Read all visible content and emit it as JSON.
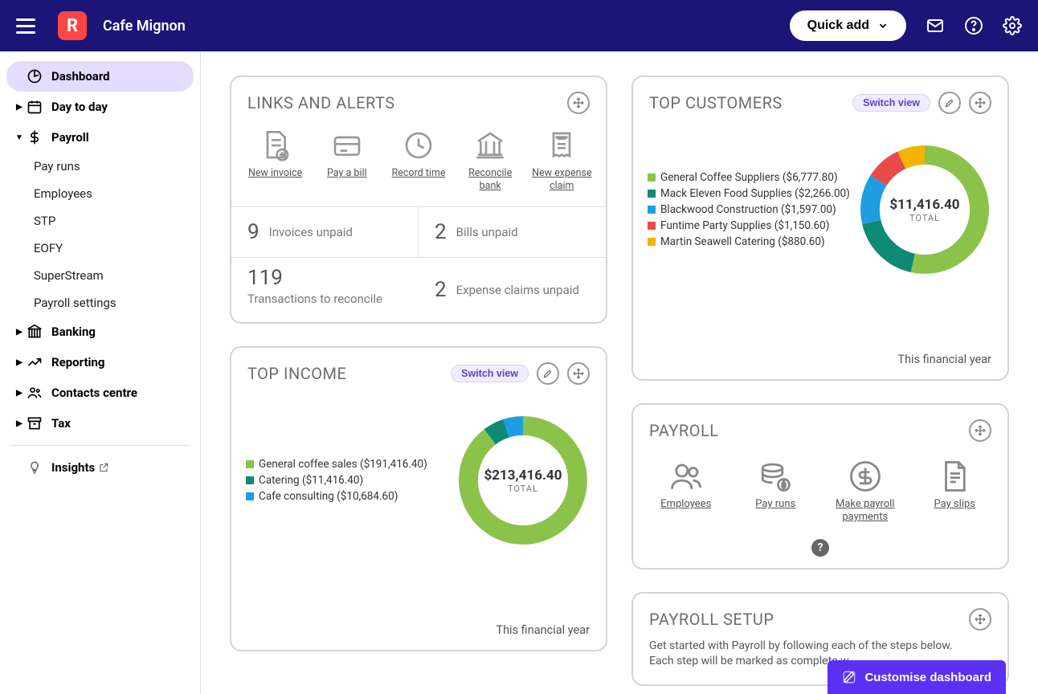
{
  "header": {
    "company_name": "Cafe Mignon",
    "quick_add_label": "Quick add"
  },
  "sidebar": {
    "items": [
      {
        "key": "dashboard",
        "label": "Dashboard",
        "active": true,
        "expandable": false
      },
      {
        "key": "day_to_day",
        "label": "Day to day",
        "expandable": true,
        "expanded": false
      },
      {
        "key": "payroll",
        "label": "Payroll",
        "expandable": true,
        "expanded": true,
        "children": [
          {
            "key": "pay_runs",
            "label": "Pay runs"
          },
          {
            "key": "employees",
            "label": "Employees"
          },
          {
            "key": "stp",
            "label": "STP"
          },
          {
            "key": "eofy",
            "label": "EOFY"
          },
          {
            "key": "superstream",
            "label": "SuperStream"
          },
          {
            "key": "payroll_settings",
            "label": "Payroll settings"
          }
        ]
      },
      {
        "key": "banking",
        "label": "Banking",
        "expandable": true,
        "expanded": false
      },
      {
        "key": "reporting",
        "label": "Reporting",
        "expandable": true,
        "expanded": false
      },
      {
        "key": "contacts",
        "label": "Contacts centre",
        "expandable": true,
        "expanded": false
      },
      {
        "key": "tax",
        "label": "Tax",
        "expandable": true,
        "expanded": false
      }
    ],
    "insights_label": "Insights"
  },
  "links_card": {
    "title": "LINKS AND ALERTS",
    "quick_links": [
      {
        "key": "new_invoice",
        "label": "New invoice"
      },
      {
        "key": "pay_bill",
        "label": "Pay a bill"
      },
      {
        "key": "record_time",
        "label": "Record time"
      },
      {
        "key": "reconcile",
        "label": "Reconcile bank"
      },
      {
        "key": "new_expense",
        "label": "New expense claim"
      }
    ],
    "stats": {
      "invoices_unpaid_num": "9",
      "invoices_unpaid_cap": "Invoices unpaid",
      "bills_unpaid_num": "2",
      "bills_unpaid_cap": "Bills unpaid",
      "tx_reconcile_num": "119",
      "tx_reconcile_cap": "Transactions to reconcile",
      "expense_unpaid_num": "2",
      "expense_unpaid_cap": "Expense claims unpaid"
    }
  },
  "top_income": {
    "title": "TOP INCOME",
    "switch_view": "Switch view",
    "total": "$213,416.40",
    "total_label": "TOTAL",
    "footer": "This financial year",
    "legend": [
      {
        "label": "General coffee sales ($191,416.40)",
        "color": "#8bc34a",
        "value": 191416.4
      },
      {
        "label": "Catering ($11,416.40)",
        "color": "#0e8a74",
        "value": 11416.4
      },
      {
        "label": "Cafe consulting ($10,684.60)",
        "color": "#1e9ee1",
        "value": 10684.6
      }
    ]
  },
  "top_customers": {
    "title": "TOP CUSTOMERS",
    "switch_view": "Switch view",
    "total": "$11,416.40",
    "total_label": "TOTAL",
    "footer": "This financial year",
    "legend": [
      {
        "label": "General Coffee Suppliers ($6,777.80)",
        "color": "#8bc34a",
        "value": 6777.8
      },
      {
        "label": "Mack Eleven Food Supplies ($2,266.00)",
        "color": "#0e8a74",
        "value": 2266.0
      },
      {
        "label": "Blackwood Construction ($1,597.00)",
        "color": "#1e9ee1",
        "value": 1597.0
      },
      {
        "label": "Funtime Party Supplies ($1,150.60)",
        "color": "#e94b4b",
        "value": 1150.6
      },
      {
        "label": "Martin Seawell Catering ($880.60)",
        "color": "#f4b400",
        "value": 880.6
      }
    ]
  },
  "payroll_card": {
    "title": "PAYROLL",
    "links": [
      {
        "key": "employees",
        "label": "Employees"
      },
      {
        "key": "pay_runs",
        "label": "Pay runs"
      },
      {
        "key": "payments",
        "label": "Make payroll payments"
      },
      {
        "key": "pay_slips",
        "label": "Pay slips"
      }
    ]
  },
  "payroll_setup": {
    "title": "PAYROLL SETUP",
    "line1": "Get started with Payroll by following each of the steps below.",
    "line2": "Each step will be marked as complete w"
  },
  "customise_label": "Customise dashboard",
  "chart_data": [
    {
      "type": "pie",
      "name": "Top Income",
      "title": "TOP INCOME",
      "total_label": "$213,416.40 TOTAL",
      "series": [
        {
          "name": "General coffee sales",
          "value": 191416.4
        },
        {
          "name": "Catering",
          "value": 11416.4
        },
        {
          "name": "Cafe consulting",
          "value": 10684.6
        }
      ]
    },
    {
      "type": "pie",
      "name": "Top Customers",
      "title": "TOP CUSTOMERS",
      "total_label": "$11,416.40 TOTAL",
      "series": [
        {
          "name": "General Coffee Suppliers",
          "value": 6777.8
        },
        {
          "name": "Mack Eleven Food Supplies",
          "value": 2266.0
        },
        {
          "name": "Blackwood Construction",
          "value": 1597.0
        },
        {
          "name": "Funtime Party Supplies",
          "value": 1150.6
        },
        {
          "name": "Martin Seawell Catering",
          "value": 880.6
        }
      ]
    }
  ]
}
